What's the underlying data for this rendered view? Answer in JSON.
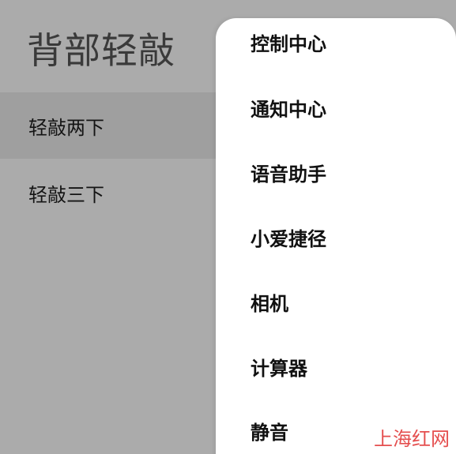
{
  "page": {
    "title": "背部轻敲"
  },
  "options": [
    {
      "label": "轻敲两下",
      "selected": true
    },
    {
      "label": "轻敲三下",
      "selected": false
    }
  ],
  "dropdown": {
    "items": [
      {
        "label": "控制中心"
      },
      {
        "label": "通知中心"
      },
      {
        "label": "语音助手"
      },
      {
        "label": "小爱捷径"
      },
      {
        "label": "相机"
      },
      {
        "label": "计算器"
      },
      {
        "label": "静音"
      }
    ]
  },
  "watermark": {
    "text": "上海红网",
    "color": "#e23b3b"
  },
  "colors": {
    "overlay_bg": "#ababab",
    "selected_row": "#9f9f9f",
    "menu_bg": "#ffffff"
  }
}
